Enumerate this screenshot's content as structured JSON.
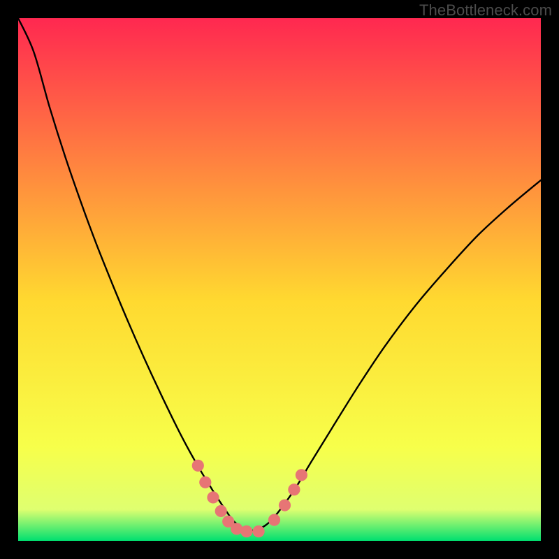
{
  "watermark": "TheBottleneck.com",
  "chart_data": {
    "type": "line",
    "title": "",
    "xlabel": "",
    "ylabel": "",
    "xlim": [
      0,
      1
    ],
    "ylim": [
      0,
      1
    ],
    "background_gradient": [
      "#ff2850",
      "#ffd930",
      "#f7ff4a",
      "#00e070"
    ],
    "series": [
      {
        "name": "curve",
        "color": "#000000",
        "x": [
          0.0,
          0.03,
          0.06,
          0.09,
          0.12,
          0.15,
          0.18,
          0.21,
          0.24,
          0.27,
          0.3,
          0.32,
          0.34,
          0.36,
          0.37,
          0.38,
          0.39,
          0.4,
          0.41,
          0.42,
          0.43,
          0.44,
          0.45,
          0.46,
          0.48,
          0.5,
          0.53,
          0.56,
          0.6,
          0.65,
          0.7,
          0.76,
          0.82,
          0.88,
          0.94,
          1.0
        ],
        "y": [
          1.0,
          0.935,
          0.83,
          0.735,
          0.648,
          0.567,
          0.492,
          0.42,
          0.352,
          0.287,
          0.225,
          0.186,
          0.15,
          0.116,
          0.1,
          0.084,
          0.069,
          0.054,
          0.04,
          0.031,
          0.023,
          0.02,
          0.02,
          0.022,
          0.035,
          0.058,
          0.1,
          0.15,
          0.215,
          0.295,
          0.37,
          0.45,
          0.52,
          0.585,
          0.64,
          0.69
        ]
      }
    ],
    "bottom_markers": {
      "color": "#e77575",
      "radius": 0.0115,
      "points": [
        {
          "x": 0.344,
          "y": 0.144
        },
        {
          "x": 0.358,
          "y": 0.112
        },
        {
          "x": 0.373,
          "y": 0.083
        },
        {
          "x": 0.388,
          "y": 0.057
        },
        {
          "x": 0.402,
          "y": 0.037
        },
        {
          "x": 0.418,
          "y": 0.023
        },
        {
          "x": 0.437,
          "y": 0.018
        },
        {
          "x": 0.46,
          "y": 0.018
        },
        {
          "x": 0.49,
          "y": 0.04
        },
        {
          "x": 0.51,
          "y": 0.068
        },
        {
          "x": 0.528,
          "y": 0.098
        },
        {
          "x": 0.542,
          "y": 0.126
        }
      ]
    }
  }
}
